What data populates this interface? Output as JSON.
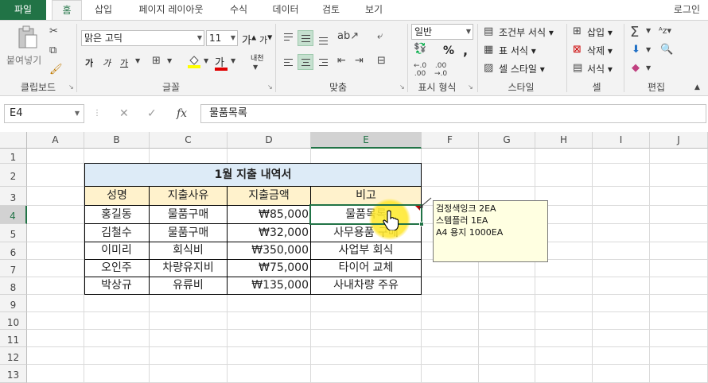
{
  "tabs": [
    "파일",
    "홈",
    "삽입",
    "페이지 레이아웃",
    "수식",
    "데이터",
    "검토",
    "보기"
  ],
  "active_tab": "홈",
  "login_label": "로그인",
  "ribbon": {
    "clipboard": {
      "paste": "붙여넣기",
      "label": "클립보드"
    },
    "font": {
      "name": "맑은 고딕",
      "size": "11",
      "label": "글꼴",
      "bold": "가",
      "italic": "가",
      "underline": "가",
      "font_color": "가",
      "phonetic": "내천"
    },
    "alignment": {
      "label": "맞춤"
    },
    "number": {
      "format": "일반",
      "percent": "%",
      "comma": ",",
      "label": "표시 형식"
    },
    "styles": {
      "conditional": "조건부 서식",
      "table": "표 서식",
      "cell": "셀 스타일",
      "label": "스타일"
    },
    "cells": {
      "insert": "삽입",
      "delete": "삭제",
      "format": "서식",
      "label": "셀"
    },
    "editing": {
      "label": "편집"
    }
  },
  "formula_bar": {
    "cell_ref": "E4",
    "fx": "fx",
    "value": "물품목록"
  },
  "columns": [
    "A",
    "B",
    "C",
    "D",
    "E",
    "F",
    "G",
    "H",
    "I",
    "J"
  ],
  "selected_column": "E",
  "rows": [
    "1",
    "2",
    "3",
    "4",
    "5",
    "6",
    "7",
    "8",
    "9",
    "10",
    "11",
    "12",
    "13"
  ],
  "selected_row": "4",
  "sheet": {
    "title": "1월 지출 내역서",
    "headers": [
      "성명",
      "지출사유",
      "지출금액",
      "비고"
    ],
    "data": [
      [
        "홍길동",
        "물품구매",
        "₩85,000",
        "물품목록"
      ],
      [
        "김철수",
        "물품구매",
        "₩32,000",
        "사무용품 구매"
      ],
      [
        "이미리",
        "회식비",
        "₩350,000",
        "사업부 회식"
      ],
      [
        "오인주",
        "차량유지비",
        "₩75,000",
        "타이어 교체"
      ],
      [
        "박상규",
        "유류비",
        "₩135,000",
        "사내차량 주유"
      ]
    ]
  },
  "comment": [
    "검정색잉크 2EA",
    "스템플러 1EA",
    "A4 용지 1000EA"
  ]
}
